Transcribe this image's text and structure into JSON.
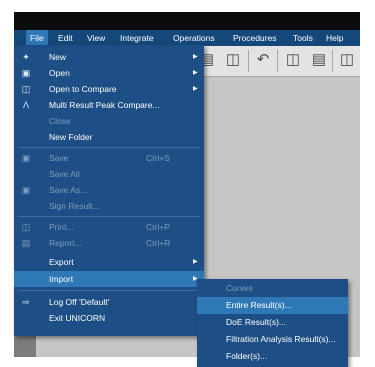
{
  "menubar": {
    "items": [
      "File",
      "Edit",
      "View",
      "Integrate",
      "Operations",
      "Procedures",
      "Tools",
      "Help"
    ]
  },
  "toolbar": {
    "icons": [
      "copy-icon",
      "clipboard-icon",
      "undo-arrow-icon",
      "monitor-icon",
      "document-icon",
      "network-icon"
    ]
  },
  "file_menu": {
    "items": [
      {
        "label": "New",
        "icon": "new-icon",
        "submenu": true,
        "enabled": true
      },
      {
        "label": "Open",
        "icon": "folder-icon",
        "submenu": true,
        "enabled": true
      },
      {
        "label": "Open to Compare",
        "icon": "compare-icon",
        "submenu": true,
        "enabled": true
      },
      {
        "label": "Multi Result Peak Compare...",
        "icon": "peak-compare-icon",
        "submenu": false,
        "enabled": true
      },
      {
        "label": "Close",
        "enabled": false
      },
      {
        "label": "New Folder",
        "enabled": true
      },
      {
        "label": "Save",
        "shortcut": "Ctrl+S",
        "icon": "save-icon",
        "enabled": false
      },
      {
        "label": "Save All",
        "enabled": false
      },
      {
        "label": "Save As...",
        "icon": "save-as-icon",
        "enabled": false
      },
      {
        "label": "Sign Result...",
        "enabled": false
      },
      {
        "label": "Print...",
        "shortcut": "Ctrl+P",
        "icon": "print-icon",
        "enabled": false
      },
      {
        "label": "Report...",
        "shortcut": "Ctrl+R",
        "icon": "report-icon",
        "enabled": false
      },
      {
        "label": "Export",
        "submenu": true,
        "enabled": true
      },
      {
        "label": "Import",
        "submenu": true,
        "enabled": true,
        "selected": true
      },
      {
        "label": "Log Off 'Default'",
        "icon": "log-off-icon",
        "enabled": true
      },
      {
        "label": "Exit UNICORN",
        "enabled": true
      }
    ]
  },
  "import_submenu": {
    "items": [
      {
        "label": "Curves",
        "enabled": false
      },
      {
        "label": "Entire Result(s)...",
        "enabled": true,
        "hover": true
      },
      {
        "label": "DoE Result(s)...",
        "enabled": true
      },
      {
        "label": "Filtration Analysis Result(s)...",
        "enabled": true
      },
      {
        "label": "Folder(s)...",
        "enabled": true
      }
    ]
  },
  "colors": {
    "menu_bg": "#1d4f86",
    "highlight": "#2f78b6",
    "menubar_bg": "#15487a",
    "disabled_text": "#7f9cbe"
  }
}
